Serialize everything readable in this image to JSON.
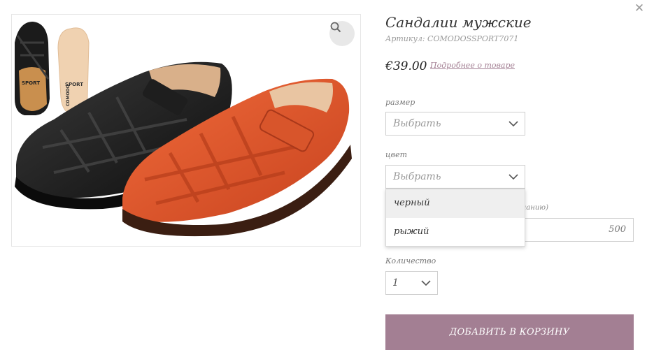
{
  "product": {
    "title": "Сандалии мужские",
    "sku": "Артикул: COMODOSSPORT7071",
    "price": "€39.00",
    "more_link": "Подробнее о товаре"
  },
  "gallery": {
    "insole_brand_top": "SPORT",
    "insole_brand_bottom": "COMODO",
    "icons": [
      "zoom-icon"
    ]
  },
  "options": {
    "size": {
      "label": "размер",
      "value": "Выбрать"
    },
    "color": {
      "label": "цвет",
      "value": "Выбрать",
      "dropdown_open": true,
      "items": [
        "черный",
        "рыжий"
      ]
    },
    "extra": {
      "label_visible_part": "еланию)",
      "value": "500"
    },
    "quantity": {
      "label": "Количество",
      "value": "1"
    }
  },
  "cart": {
    "add_label": "ДОБАВИТЬ В КОРЗИНУ"
  },
  "colors": {
    "accent": "#a37f93",
    "border": "#cfcfcf",
    "highlight": "#efefef"
  }
}
